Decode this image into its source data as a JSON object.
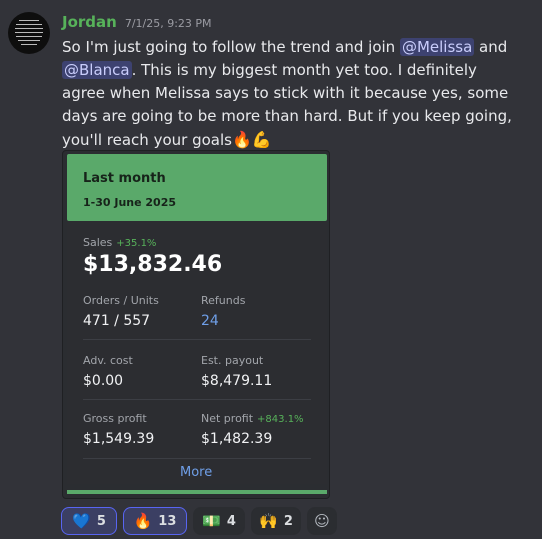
{
  "message": {
    "username": "Jordan",
    "timestamp": "7/1/25, 9:23 PM",
    "text_part1": "So I'm just going to follow the trend and join ",
    "mention1": "@Melissa",
    "text_part2": " and ",
    "mention2": "@Blanca",
    "text_part3": ". This is my biggest month yet too. I definitely agree when Melissa says to stick with it because yes, some days are going to be more than hard. But if you keep going, you'll reach your goals",
    "emoji1": "🔥",
    "emoji2": "💪"
  },
  "card": {
    "title": "Last month",
    "date_range": "1-30 June 2025",
    "sales": {
      "label": "Sales",
      "change": "+35.1%",
      "value": "$13,832.46"
    },
    "orders": {
      "label": "Orders / Units",
      "value": "471 / 557"
    },
    "refunds": {
      "label": "Refunds",
      "value": "24"
    },
    "adv_cost": {
      "label": "Adv. cost",
      "value": "$0.00"
    },
    "est_payout": {
      "label": "Est. payout",
      "value": "$8,479.11"
    },
    "gross_profit": {
      "label": "Gross profit",
      "value": "$1,549.39"
    },
    "net_profit": {
      "label": "Net profit",
      "change": "+843.1%",
      "value": "$1,482.39"
    },
    "more_label": "More"
  },
  "reactions": [
    {
      "emoji": "💙",
      "count": "5",
      "icon": "heart-icon"
    },
    {
      "emoji": "🔥",
      "count": "13",
      "icon": "fire-icon"
    },
    {
      "emoji": "💵",
      "count": "4",
      "icon": "money-icon"
    },
    {
      "emoji": "🙌",
      "count": "2",
      "icon": "raised-hands-icon"
    },
    {
      "emoji": "☺",
      "icon": "add-reaction-icon"
    }
  ],
  "colors": {
    "background": "#323339",
    "username": "#57b25a",
    "card_accent": "#5aa96a",
    "mention_bg": "#3d4270",
    "link": "#6f9fe8"
  }
}
